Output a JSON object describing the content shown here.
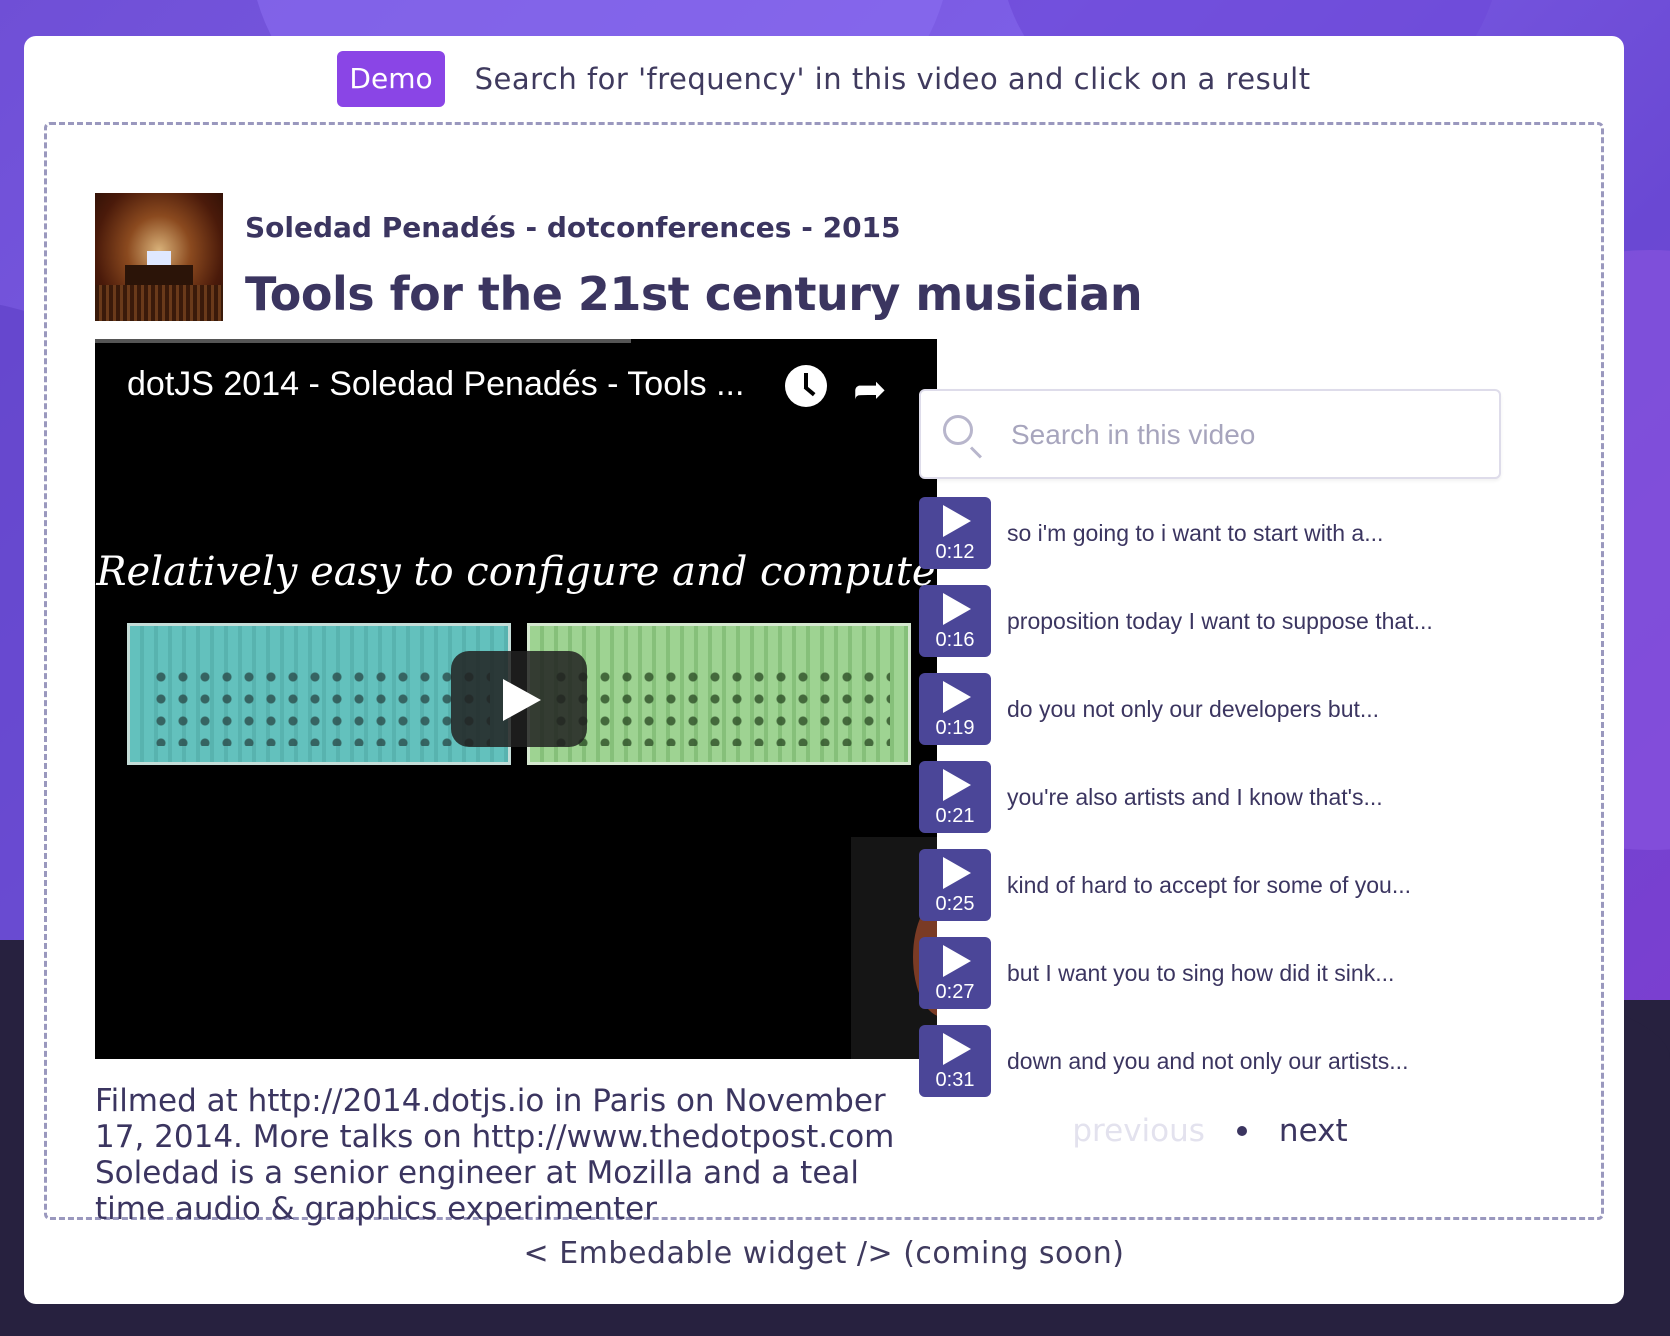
{
  "header": {
    "badge": "Demo",
    "instruction": "Search for 'frequency' in this video and click on a result"
  },
  "video": {
    "author_line": "Soledad Penadés - dotconferences - 2015",
    "title": "Tools for the 21st century musician",
    "player_title": "dotJS 2014 - Soledad Penadés - Tools ...",
    "slide_caption": "Relatively easy to configure and compute",
    "description": "Filmed at http://2014.dotjs.io in Paris on November 17, 2014. More talks on http://www.thedotpost.com Soledad is a senior engineer at Mozilla and a teal time audio & graphics experimenter"
  },
  "search": {
    "placeholder": "Search in this video"
  },
  "results": [
    {
      "time": "0:12",
      "text": "so i'm going to i want to start with a..."
    },
    {
      "time": "0:16",
      "text": "proposition today I want to suppose that..."
    },
    {
      "time": "0:19",
      "text": "do you not only our developers but..."
    },
    {
      "time": "0:21",
      "text": "you're also artists and I know that's..."
    },
    {
      "time": "0:25",
      "text": "kind of hard to accept for some of you..."
    },
    {
      "time": "0:27",
      "text": "but I want you to sing how did it sink..."
    },
    {
      "time": "0:31",
      "text": "down and you and not only our artists..."
    }
  ],
  "pager": {
    "previous": "previous",
    "next": "next"
  },
  "footer": "< Embedable widget /> (coming soon)",
  "colors": {
    "accent": "#8a45e6",
    "result_button": "#4b4698",
    "text": "#3b3560"
  }
}
